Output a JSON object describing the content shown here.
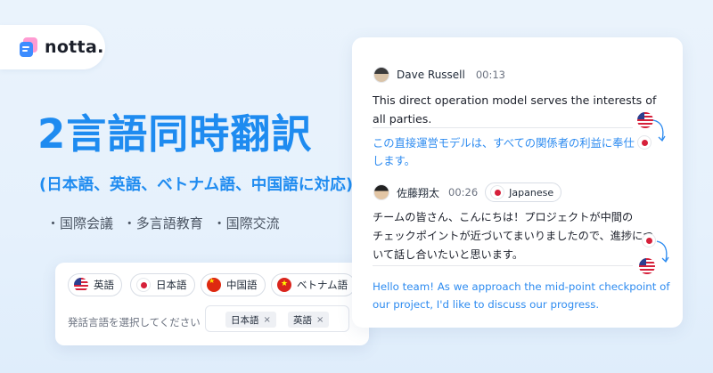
{
  "brand": {
    "name": "notta."
  },
  "headline": "2言語同時翻訳",
  "subline": "(日本語、英語、ベトナム語、中国語に対応)",
  "uses": [
    "・国際会議",
    "・多言語教育",
    "・国際交流"
  ],
  "language_selector": {
    "options": [
      {
        "label": "英語",
        "flag": "us-flag-icon"
      },
      {
        "label": "日本語",
        "flag": "jp-flag-icon"
      },
      {
        "label": "中国語",
        "flag": "cn-flag-icon"
      },
      {
        "label": "ベトナム語",
        "flag": "vn-flag-icon"
      }
    ],
    "select_label": "発話言語を選択してください",
    "selected": [
      {
        "label": "日本語",
        "remove": "×"
      },
      {
        "label": "英語",
        "remove": "×"
      }
    ]
  },
  "transcript": [
    {
      "speaker": "Dave Russell",
      "time": "00:13",
      "original_lines": [
        "This direct operation model serves the interests of",
        "all parties."
      ],
      "translation_lines": [
        "この直接運営モデルは、すべての関係者の利益に奉仕",
        "します。"
      ]
    },
    {
      "speaker": "佐藤翔太",
      "time": "00:26",
      "language": "Japanese",
      "original_lines": [
        "チームの皆さん、こんにちは！プロジェクトが中間の",
        "チェックポイントが近づいてまいりましたので、進捗につ",
        "いて話し合いたいと思います。"
      ],
      "translation_lines": [
        "Hello team! As we approach the mid-point checkpoint of",
        "our project, I'd like to discuss our progress."
      ]
    }
  ],
  "colors": {
    "accent": "#1e8bf0",
    "translation": "#2d8bf0",
    "background": "#e6f1fc"
  }
}
